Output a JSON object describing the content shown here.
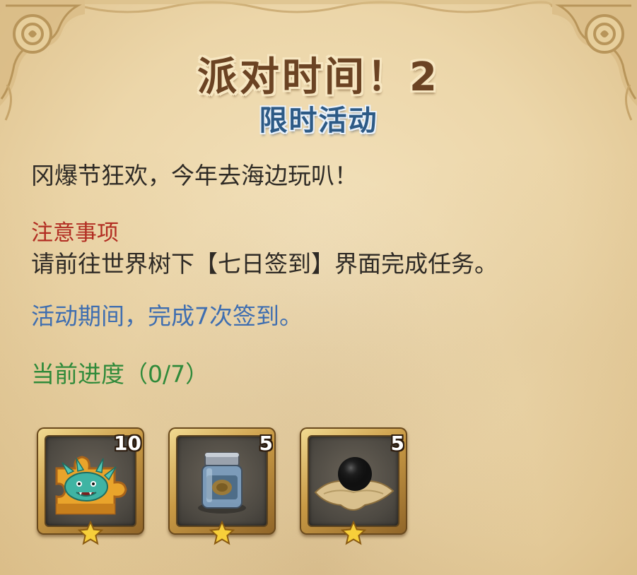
{
  "event": {
    "title": "派对时间！2",
    "subtitle": "限时活动",
    "description": "冈爆节狂欢，今年去海边玩叭！",
    "notice_title": "注意事项",
    "notice_body": "请前往世界树下【七日签到】界面完成任务。",
    "task": "活动期间，完成7次签到。",
    "progress_label": "当前进度（0/7）",
    "progress": {
      "current": 0,
      "total": 7
    }
  },
  "rewards": [
    {
      "name": "dragon-puzzle-piece-icon",
      "count": "10",
      "stars": 1
    },
    {
      "name": "jar-icon",
      "count": "5",
      "stars": 1
    },
    {
      "name": "black-orb-icon",
      "count": "5",
      "stars": 1
    }
  ],
  "colors": {
    "title": "#6b4323",
    "subtitle": "#2d5a86",
    "notice": "#b22d22",
    "task": "#3f6eb0",
    "progress": "#2f8a3a",
    "parchment": "#ecd6a9"
  }
}
